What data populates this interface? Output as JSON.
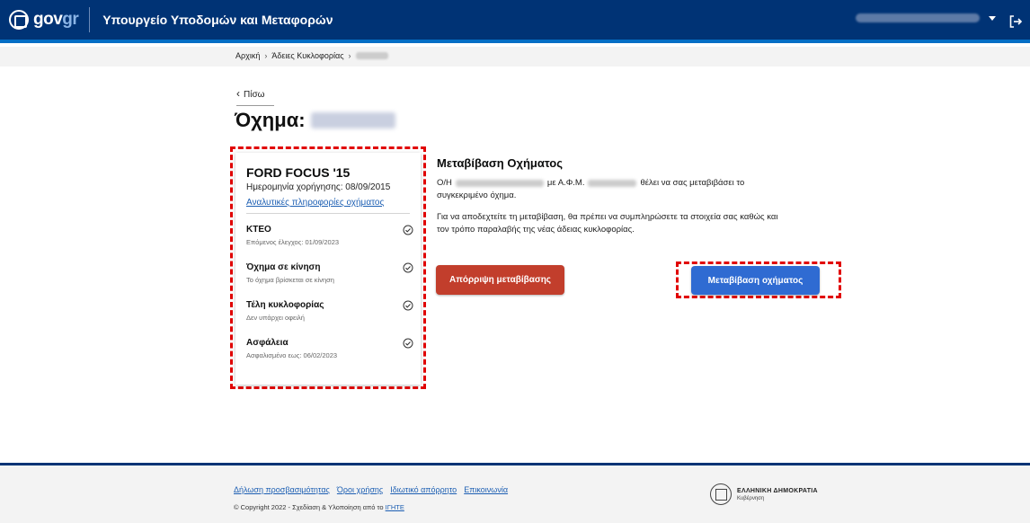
{
  "header": {
    "logo_main": "gov",
    "logo_accent": "gr",
    "ministry_title": "Υπουργείο Υποδομών και Μεταφορών"
  },
  "breadcrumb": {
    "items": [
      "Αρχική",
      "Άδειες Κυκλοφορίας"
    ]
  },
  "back_label": "Πίσω",
  "page_title_prefix": "Όχημα:",
  "vehicle_card": {
    "name": "FORD FOCUS '15",
    "registration_date": "Ημερομηνία χορήγησης: 08/09/2015",
    "details_link": "Αναλυτικές πληροφορίες οχήματος",
    "statuses": [
      {
        "title": "ΚΤΕΟ",
        "subtitle": "Επόμενος έλεγχος: 01/09/2023",
        "icon": "check-circle-icon"
      },
      {
        "title": "Όχημα σε κίνηση",
        "subtitle": "Το όχημα βρίσκεται σε κίνηση",
        "icon": "check-circle-icon"
      },
      {
        "title": "Τέλη κυκλοφορίας",
        "subtitle": "Δεν υπάρχει οφειλή",
        "icon": "check-circle-icon"
      },
      {
        "title": "Ασφάλεια",
        "subtitle": "Ασφαλισμένο εως: 06/02/2023",
        "icon": "check-circle-icon"
      }
    ]
  },
  "transfer": {
    "title": "Μεταβίβαση Οχήματος",
    "line1_prefix": "Ο/Η",
    "line1_mid": "με Α.Φ.Μ.",
    "line1_suffix": "θέλει να σας μεταβιβάσει το",
    "line2": "συγκεκριμένο όχημα.",
    "line3": "Για να αποδεχτείτε τη μεταβίβαση, θα πρέπει να συμπληρώσετε τα στοιχεία σας καθώς και",
    "line4": "τον τρόπο παραλαβής της νέας άδειας κυκλοφορίας.",
    "reject_label": "Απόρριψη μεταβίβασης",
    "accept_label": "Μεταβίβαση οχήματος"
  },
  "footer": {
    "links": [
      "Δήλωση προσβασιμότητας",
      "Όροι χρήσης",
      "Ιδιωτικό απόρρητο",
      "Επικοινωνία"
    ],
    "copyright_text": "© Copyright 2022 - Σχεδίαση & Υλοποίηση από το",
    "copyright_link": "ΙΓΗΤΕ",
    "gov_name": "ΕΛΛΗΝΙΚΗ ΔΗΜΟΚΡΑΤΙΑ",
    "gov_sub": "Κυβέρνηση"
  },
  "colors": {
    "header_bg": "#003375",
    "reject_button": "#c23e2c",
    "accept_button": "#2f6bd2",
    "annotation_red": "#e10000"
  }
}
